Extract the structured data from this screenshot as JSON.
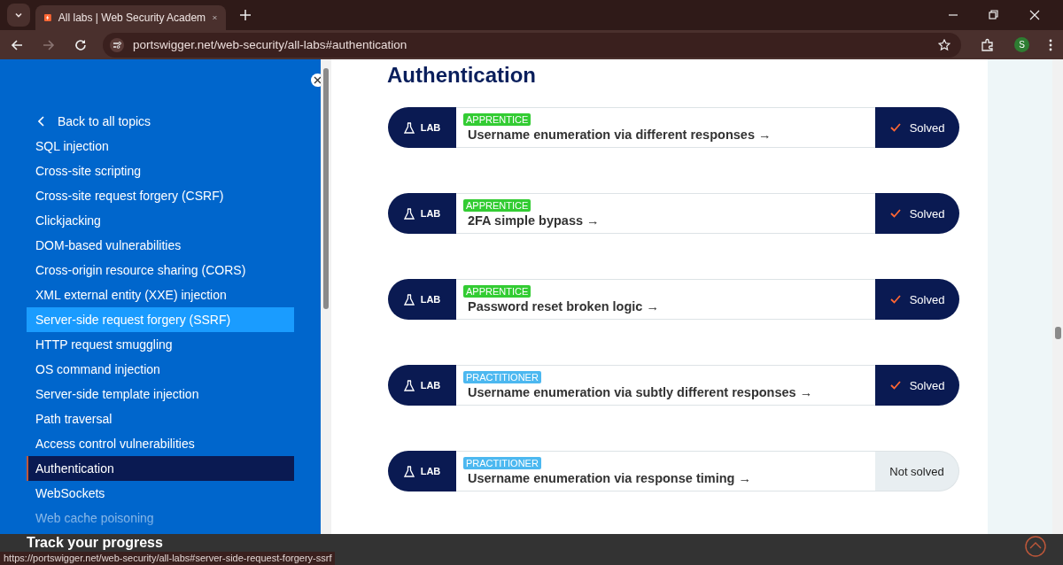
{
  "browser": {
    "tab_title": "All labs | Web Security Academ",
    "url": "portswigger.net/web-security/all-labs#authentication",
    "profile_initial": "S"
  },
  "sidebar": {
    "back_label": "Back to all topics",
    "items": [
      {
        "label": "SQL injection",
        "selected": false,
        "hovered": false
      },
      {
        "label": "Cross-site scripting",
        "selected": false,
        "hovered": false
      },
      {
        "label": "Cross-site request forgery (CSRF)",
        "selected": false,
        "hovered": false
      },
      {
        "label": "Clickjacking",
        "selected": false,
        "hovered": false
      },
      {
        "label": "DOM-based vulnerabilities",
        "selected": false,
        "hovered": false
      },
      {
        "label": "Cross-origin resource sharing (CORS)",
        "selected": false,
        "hovered": false
      },
      {
        "label": "XML external entity (XXE) injection",
        "selected": false,
        "hovered": false
      },
      {
        "label": "Server-side request forgery (SSRF)",
        "selected": false,
        "hovered": true
      },
      {
        "label": "HTTP request smuggling",
        "selected": false,
        "hovered": false
      },
      {
        "label": "OS command injection",
        "selected": false,
        "hovered": false
      },
      {
        "label": "Server-side template injection",
        "selected": false,
        "hovered": false
      },
      {
        "label": "Path traversal",
        "selected": false,
        "hovered": false
      },
      {
        "label": "Access control vulnerabilities",
        "selected": false,
        "hovered": false
      },
      {
        "label": "Authentication",
        "selected": true,
        "hovered": false
      },
      {
        "label": "WebSockets",
        "selected": false,
        "hovered": false
      },
      {
        "label": "Web cache poisoning",
        "selected": false,
        "hovered": false
      }
    ]
  },
  "section_title": "Authentication",
  "labs": [
    {
      "tag": "LAB",
      "difficulty": "APPRENTICE",
      "color": "#33cc33",
      "title": "Username enumeration via different responses →",
      "solved": true,
      "status": "Solved"
    },
    {
      "tag": "LAB",
      "difficulty": "APPRENTICE",
      "color": "#33cc33",
      "title": "2FA simple bypass →",
      "solved": true,
      "status": "Solved"
    },
    {
      "tag": "LAB",
      "difficulty": "APPRENTICE",
      "color": "#33cc33",
      "title": "Password reset broken logic →",
      "solved": true,
      "status": "Solved"
    },
    {
      "tag": "LAB",
      "difficulty": "PRACTITIONER",
      "color": "#4cb8f0",
      "title": "Username enumeration via subtly different responses →",
      "solved": true,
      "status": "Solved"
    },
    {
      "tag": "LAB",
      "difficulty": "PRACTITIONER",
      "color": "#4cb8f0",
      "title": "Username enumeration via response timing →",
      "solved": false,
      "status": "Not solved"
    }
  ],
  "progress_bar": {
    "title": "Track your progress"
  },
  "status_url": "https://portswigger.net/web-security/all-labs#server-side-request-forgery-ssrf"
}
